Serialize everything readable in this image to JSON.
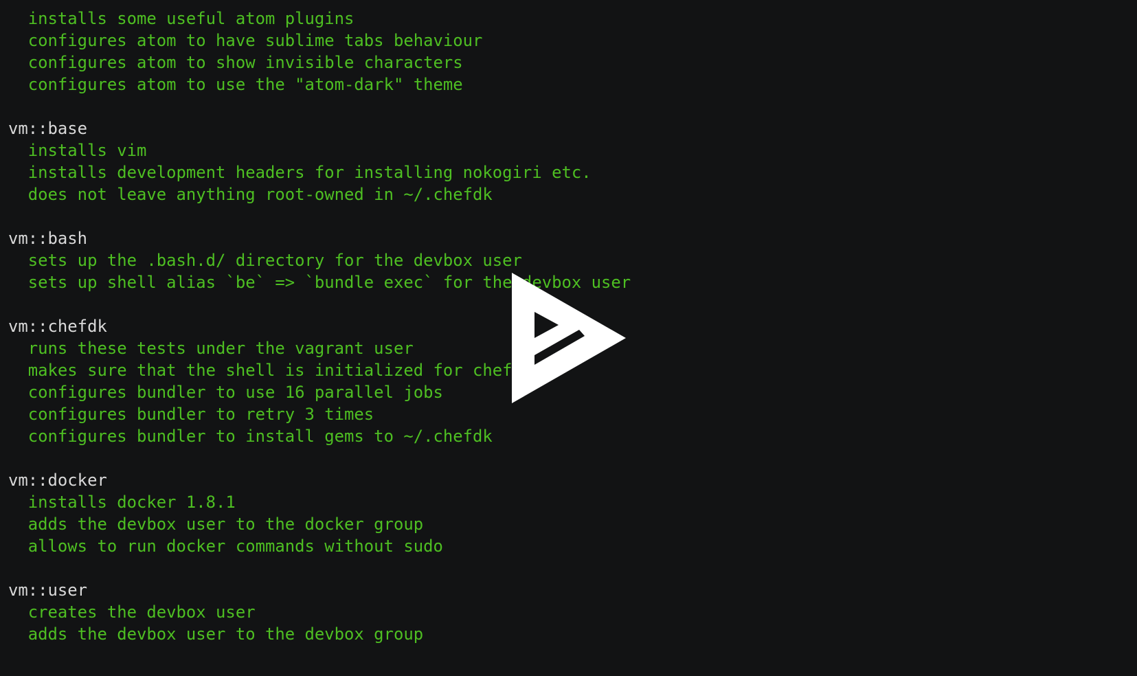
{
  "terminal": {
    "lines": [
      {
        "kind": "item",
        "text": "  installs some useful atom plugins"
      },
      {
        "kind": "item",
        "text": "  configures atom to have sublime tabs behaviour"
      },
      {
        "kind": "item",
        "text": "  configures atom to show invisible characters"
      },
      {
        "kind": "item",
        "text": "  configures atom to use the \"atom-dark\" theme"
      },
      {
        "kind": "blank",
        "text": ""
      },
      {
        "kind": "heading",
        "text": "vm::base"
      },
      {
        "kind": "item",
        "text": "  installs vim"
      },
      {
        "kind": "item",
        "text": "  installs development headers for installing nokogiri etc."
      },
      {
        "kind": "item",
        "text": "  does not leave anything root-owned in ~/.chefdk"
      },
      {
        "kind": "blank",
        "text": ""
      },
      {
        "kind": "heading",
        "text": "vm::bash"
      },
      {
        "kind": "item",
        "text": "  sets up the .bash.d/ directory for the devbox user"
      },
      {
        "kind": "item",
        "text": "  sets up shell alias `be` => `bundle exec` for the devbox user"
      },
      {
        "kind": "blank",
        "text": ""
      },
      {
        "kind": "heading",
        "text": "vm::chefdk"
      },
      {
        "kind": "item",
        "text": "  runs these tests under the vagrant user"
      },
      {
        "kind": "item",
        "text": "  makes sure that the shell is initialized for chefdk"
      },
      {
        "kind": "item",
        "text": "  configures bundler to use 16 parallel jobs"
      },
      {
        "kind": "item",
        "text": "  configures bundler to retry 3 times"
      },
      {
        "kind": "item",
        "text": "  configures bundler to install gems to ~/.chefdk"
      },
      {
        "kind": "blank",
        "text": ""
      },
      {
        "kind": "heading",
        "text": "vm::docker"
      },
      {
        "kind": "item",
        "text": "  installs docker 1.8.1"
      },
      {
        "kind": "item",
        "text": "  adds the devbox user to the docker group"
      },
      {
        "kind": "item",
        "text": "  allows to run docker commands without sudo"
      },
      {
        "kind": "blank",
        "text": ""
      },
      {
        "kind": "heading",
        "text": "vm::user"
      },
      {
        "kind": "item",
        "text": "  creates the devbox user"
      },
      {
        "kind": "item",
        "text": "  adds the devbox user to the devbox group"
      }
    ]
  },
  "player": {
    "play_icon": "play-icon"
  },
  "colors": {
    "background": "#121314",
    "heading_text": "#d9d9d9",
    "item_text": "#4ebf22",
    "play_icon": "#ffffff"
  }
}
